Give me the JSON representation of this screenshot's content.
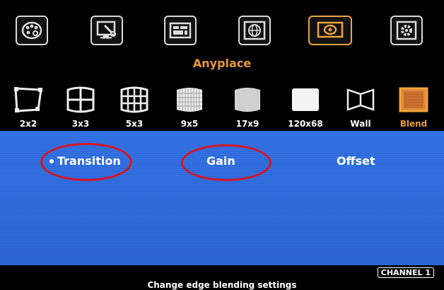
{
  "top_menu": {
    "items": [
      {
        "icon": "palette-icon"
      },
      {
        "icon": "display-settings-icon"
      },
      {
        "icon": "layout-icon"
      },
      {
        "icon": "globe-icon"
      },
      {
        "icon": "projector-icon",
        "active": true
      },
      {
        "icon": "gear-icon"
      }
    ],
    "active_title": "Anyplace",
    "accent_color": "#e79b34"
  },
  "layouts": [
    {
      "label": "2x2",
      "icon": "corner-adjust-icon"
    },
    {
      "label": "3x3",
      "icon": "grid-3x3-icon"
    },
    {
      "label": "5x3",
      "icon": "grid-5x3-icon"
    },
    {
      "label": "9x5",
      "icon": "grid-9x5-icon"
    },
    {
      "label": "17x9",
      "icon": "grid-17x9-icon"
    },
    {
      "label": "120x68",
      "icon": "fine-grid-icon"
    },
    {
      "label": "Wall",
      "icon": "wall-icon"
    },
    {
      "label": "Blend",
      "icon": "blend-icon",
      "active": true
    }
  ],
  "panel": {
    "background": "#2f6ee0",
    "items": [
      {
        "label": "Transition",
        "selected": true
      },
      {
        "label": "Gain"
      },
      {
        "label": "Offset"
      }
    ],
    "highlight_color": "#d9121f"
  },
  "status": {
    "hint": "Change edge blending settings",
    "channel": "CHANNEL 1"
  }
}
